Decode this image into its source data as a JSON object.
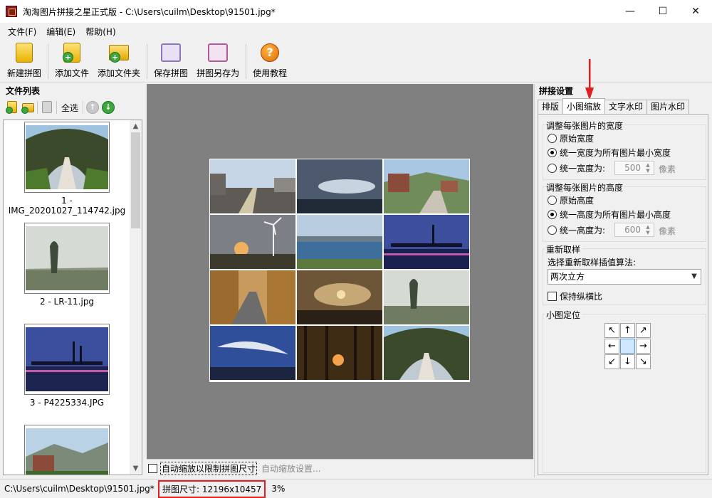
{
  "window": {
    "title": "淘淘图片拼接之星正式版 - C:\\Users\\cuilm\\Desktop\\91501.jpg*",
    "minimize": "—",
    "maximize": "☐",
    "close": "✕"
  },
  "menu": [
    "文件(F)",
    "编辑(E)",
    "帮助(H)"
  ],
  "toolbar": {
    "new": "新建拼图",
    "add_file": "添加文件",
    "add_folder": "添加文件夹",
    "save": "保存拼图",
    "save_as": "拼图另存为",
    "tutorial": "使用教程"
  },
  "file_panel": {
    "title": "文件列表",
    "select_all": "全选",
    "items": [
      {
        "label": "1 - IMG_20201027_114742.jpg"
      },
      {
        "label": "2 - LR-11.jpg"
      },
      {
        "label": "3 - P4225334.JPG"
      }
    ]
  },
  "canvas_bottom": {
    "auto_scale": "自动缩放以限制拼图尺寸",
    "auto_scale_settings": "自动缩放设置..."
  },
  "settings": {
    "title": "拼接设置",
    "tabs": [
      "排版",
      "小图缩放",
      "文字水印",
      "图片水印"
    ],
    "active_tab": 1,
    "width_group": {
      "title": "调整每张图片的宽度",
      "original": "原始宽度",
      "unify_min": "统一宽度为所有图片最小宽度",
      "unify_to": "统一宽度为:",
      "value": "500",
      "unit": "像素"
    },
    "height_group": {
      "title": "调整每张图片的高度",
      "original": "原始高度",
      "unify_min": "统一高度为所有图片最小高度",
      "unify_to": "统一高度为:",
      "value": "600",
      "unit": "像素"
    },
    "resample_group": {
      "title": "重新取样",
      "algo_label": "选择重新取样插值算法:",
      "algo_value": "两次立方",
      "keep_ratio": "保持纵横比"
    },
    "position_group": {
      "title": "小图定位",
      "arrows": [
        "↖",
        "↑",
        "↗",
        "←",
        "",
        "→",
        "↙",
        "↓",
        "↘"
      ]
    }
  },
  "status": {
    "path": "C:\\Users\\cuilm\\Desktop\\91501.jpg*",
    "size": "拼图尺寸: 12196x10457",
    "zoom": "3%"
  },
  "colors": {
    "canvas_bg": "#808080",
    "highlight_red": "#e02020",
    "selected_cell": "#cfe8ff"
  }
}
